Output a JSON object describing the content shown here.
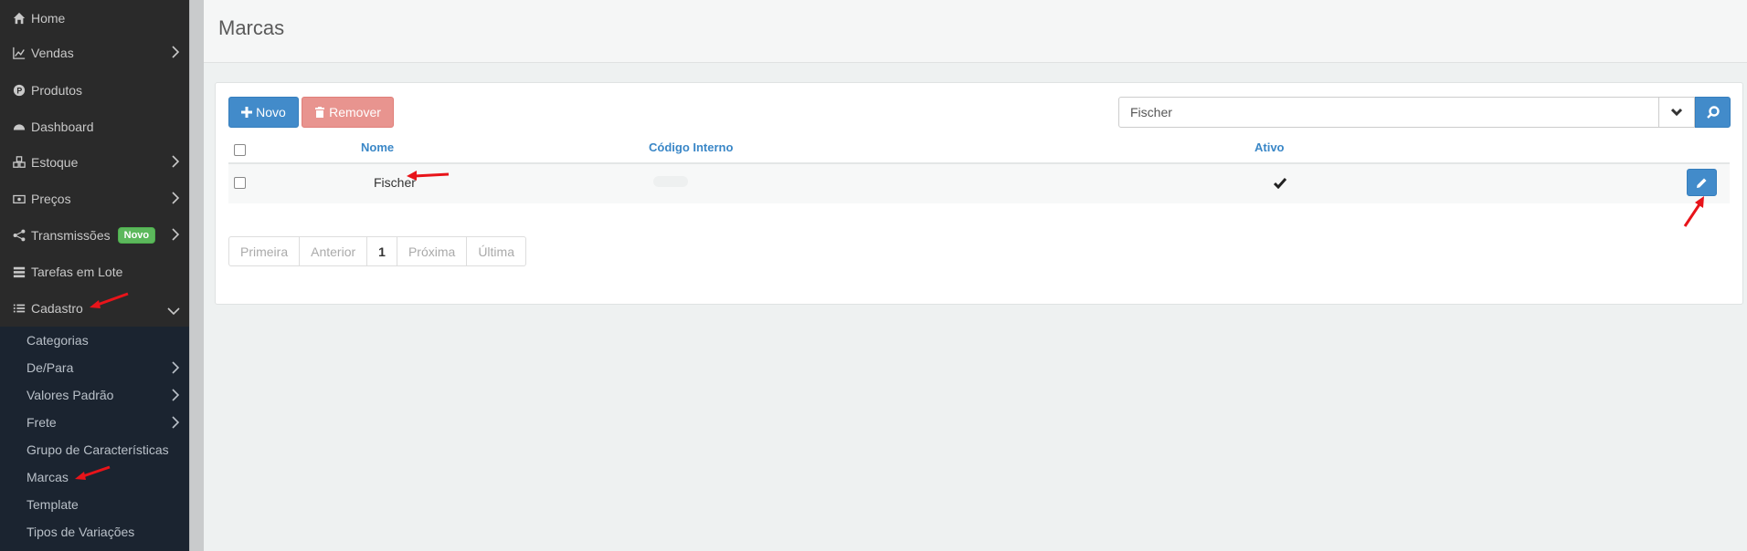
{
  "sidebar": {
    "items": [
      {
        "label": "Home",
        "icon": "home-icon"
      },
      {
        "label": "Vendas",
        "icon": "chart-line-icon"
      },
      {
        "label": "Produtos",
        "icon": "product-icon"
      },
      {
        "label": "Dashboard",
        "icon": "dashboard-icon"
      },
      {
        "label": "Estoque",
        "icon": "cubes-icon"
      },
      {
        "label": "Preços",
        "icon": "money-icon"
      },
      {
        "label": "Transmissões",
        "icon": "share-icon",
        "badge": "Novo"
      },
      {
        "label": "Tarefas em Lote",
        "icon": "tasks-icon"
      },
      {
        "label": "Cadastro",
        "icon": "list-icon"
      }
    ],
    "submenu": [
      {
        "label": "Categorias"
      },
      {
        "label": "De/Para"
      },
      {
        "label": "Valores Padrão"
      },
      {
        "label": "Frete"
      },
      {
        "label": "Grupo de Características"
      },
      {
        "label": "Marcas"
      },
      {
        "label": "Template"
      },
      {
        "label": "Tipos de Variações"
      }
    ]
  },
  "header": {
    "title": "Marcas"
  },
  "toolbar": {
    "new_label": "Novo",
    "remove_label": "Remover"
  },
  "search": {
    "value": "Fischer"
  },
  "table": {
    "columns": [
      "Nome",
      "Código Interno",
      "Ativo"
    ],
    "rows": [
      {
        "nome": "Fischer",
        "codigo_interno": "",
        "ativo": true
      }
    ]
  },
  "pagination": {
    "first": "Primeira",
    "prev": "Anterior",
    "current": "1",
    "next": "Próxima",
    "last": "Última"
  },
  "colors": {
    "primary": "#428bca",
    "danger_disabled": "#e8948f",
    "badge_green": "#5cb85c",
    "sidebar_bg": "#2a2a2a",
    "submenu_bg": "#1b2430",
    "annotation_red": "#e8141a"
  }
}
